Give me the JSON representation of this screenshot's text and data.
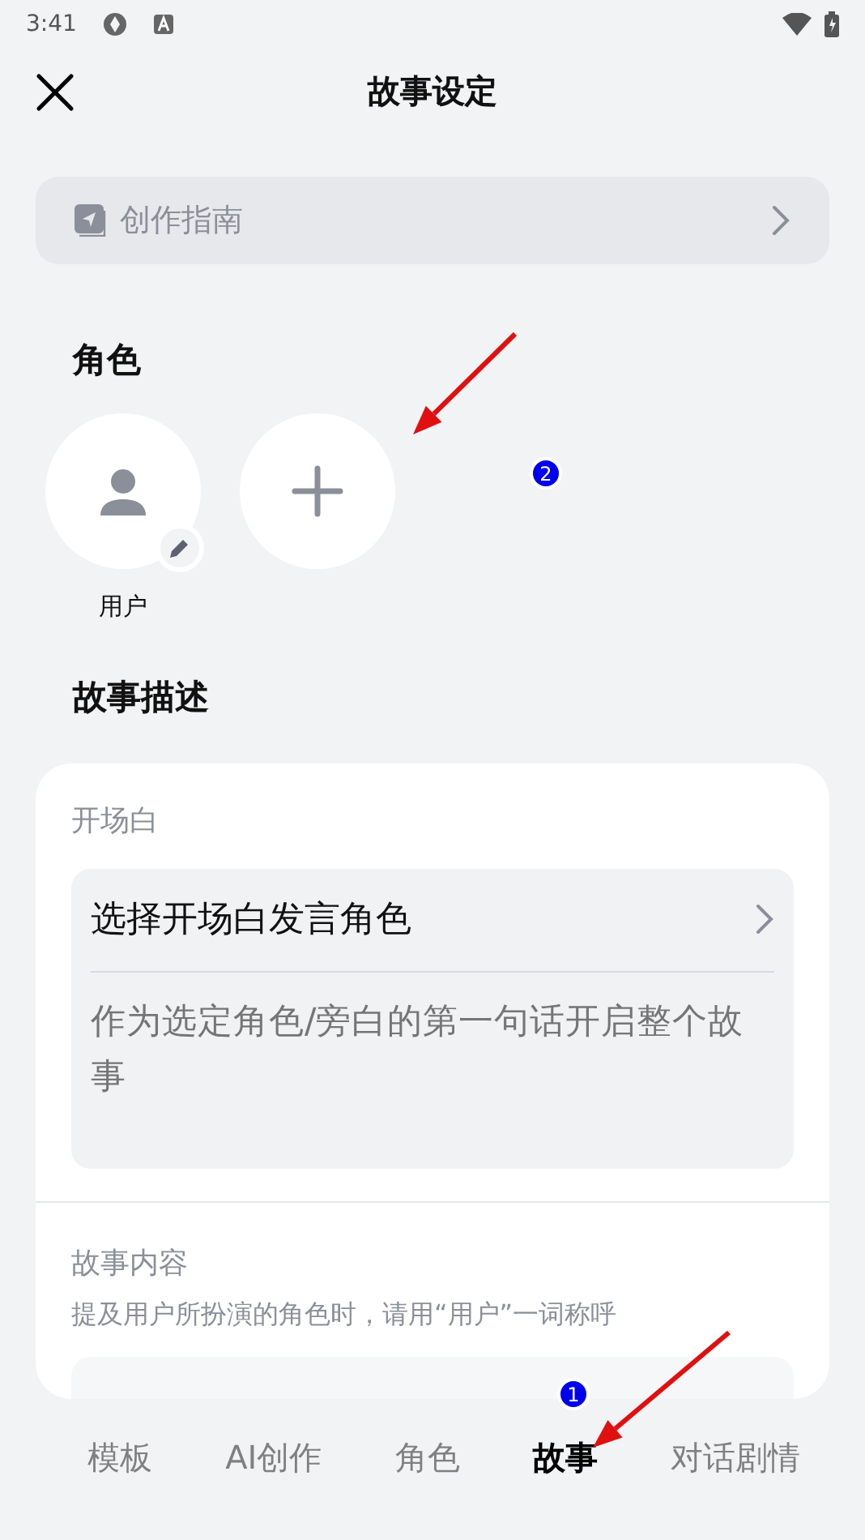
{
  "status_bar": {
    "time": "3:41"
  },
  "header": {
    "title": "故事设定"
  },
  "guide": {
    "label": "创作指南"
  },
  "roles": {
    "heading": "角色",
    "items": [
      {
        "kind": "user",
        "label": "用户",
        "editable": true
      },
      {
        "kind": "add"
      }
    ]
  },
  "story": {
    "heading": "故事描述",
    "opening": {
      "label": "开场白",
      "select_label": "选择开场白发言角色",
      "placeholder": "作为选定角色/旁白的第一句话开启整个故事"
    },
    "content": {
      "label": "故事内容",
      "hint": "提及用户所扮演的角色时，请用“用户”一词称呼"
    }
  },
  "tabs": [
    {
      "label": "模板",
      "selected": false
    },
    {
      "label": "AI创作",
      "selected": false
    },
    {
      "label": "角色",
      "selected": false
    },
    {
      "label": "故事",
      "selected": true
    },
    {
      "label": "对话剧情",
      "selected": false
    }
  ],
  "annotations": [
    {
      "number": "2"
    },
    {
      "number": "1"
    }
  ]
}
